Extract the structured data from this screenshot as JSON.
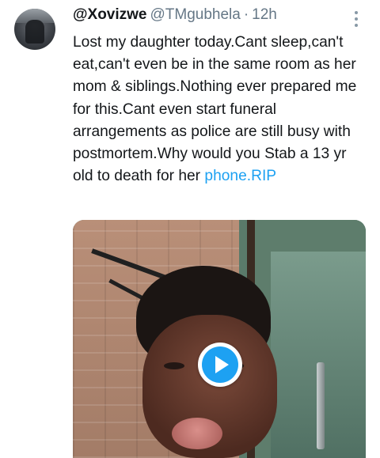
{
  "tweet": {
    "display_name": "@Xovizwe",
    "handle": "@TMgubhela",
    "separator": "·",
    "time": "12h",
    "text": "Lost my daughter today.Cant sleep,can't eat,can't even be in the same room as her mom & siblings.Nothing ever prepared me for this.Cant even start funeral arrangements as police are still busy with postmortem.Why would you Stab a 13 yr old to death for her ",
    "link_text": "phone.RIP"
  },
  "icons": {
    "more": "more-vertical-icon",
    "play": "play-icon"
  },
  "colors": {
    "link": "#1da1f2",
    "secondary_text": "#657786",
    "play_button": "#1da1f2"
  }
}
